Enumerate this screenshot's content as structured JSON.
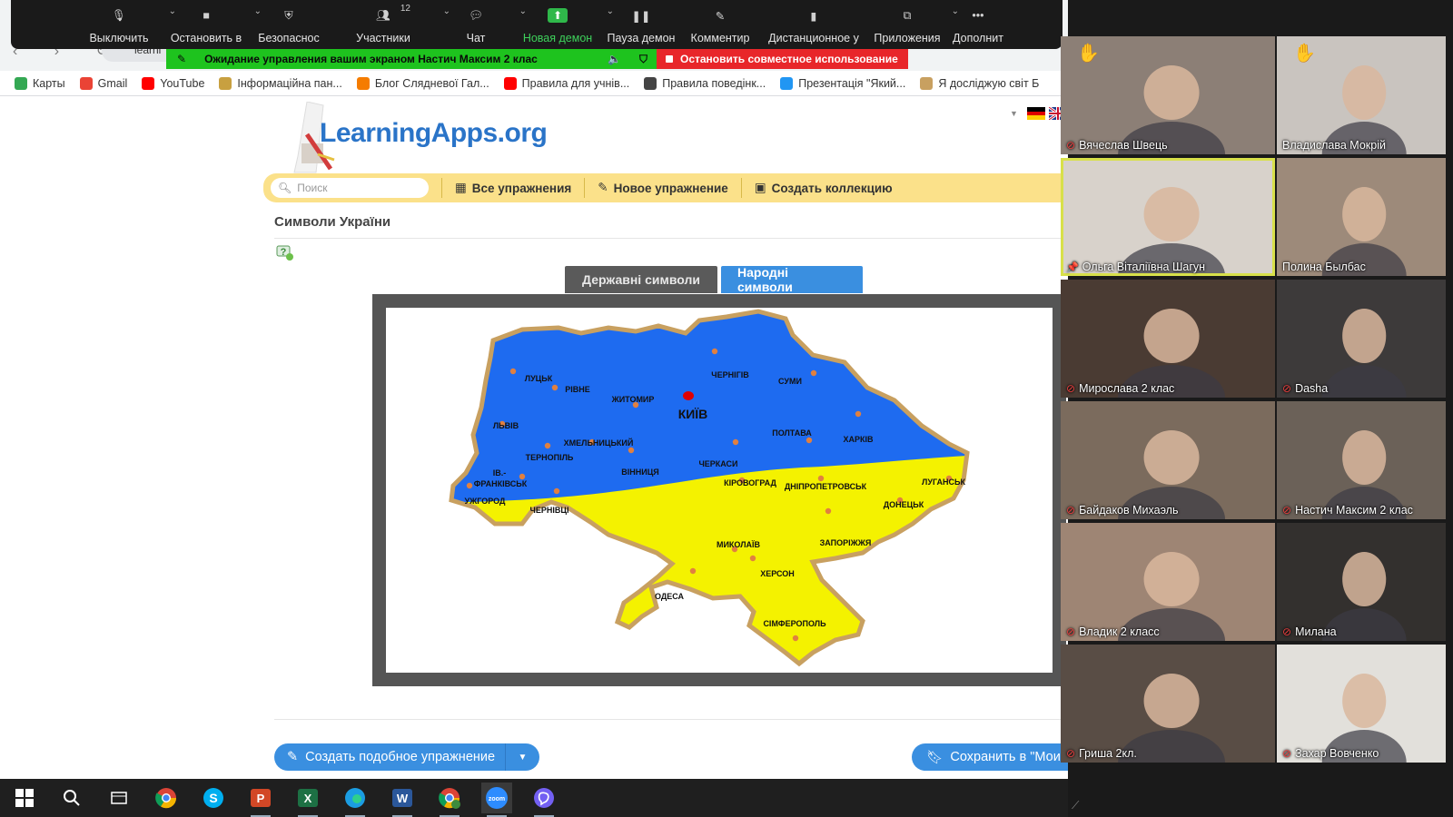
{
  "zoom_toolbar": {
    "items": [
      {
        "label": "Выключить",
        "icon": "microphone-icon"
      },
      {
        "label": "Остановить в",
        "icon": "video-camera-icon"
      },
      {
        "label": "Безопаснос",
        "icon": "shield-icon"
      },
      {
        "label": "Участники",
        "icon": "participants-icon",
        "count": "12"
      },
      {
        "label": "Чат",
        "icon": "chat-icon"
      },
      {
        "label": "Новая демон",
        "icon": "share-screen-icon"
      },
      {
        "label": "Пауза демон",
        "icon": "pause-icon"
      },
      {
        "label": "Комментир",
        "icon": "pencil-icon"
      },
      {
        "label": "Дистанционное у",
        "icon": "mouse-icon"
      },
      {
        "label": "Приложения",
        "icon": "apps-icon"
      },
      {
        "label": "Дополнит",
        "icon": "more-icon"
      }
    ],
    "sharing_banner": "Ожидание управления вашим экраном Настич Максим 2 клас",
    "stop_sharing": "Остановить совместное использование"
  },
  "browser": {
    "url_fragment": "learni",
    "bookmarks": [
      {
        "label": "Карты",
        "color": "#34a853"
      },
      {
        "label": "Gmail",
        "color": "#ea4335"
      },
      {
        "label": "YouTube",
        "color": "#ff0000"
      },
      {
        "label": "Інформаційна пан...",
        "color": "#c8a040"
      },
      {
        "label": "Блог Слядневої Гал...",
        "color": "#f57c00"
      },
      {
        "label": "Правила для учнів...",
        "color": "#ff0000"
      },
      {
        "label": "Правила поведінк...",
        "color": "#444444"
      },
      {
        "label": "Презентація \"Який...",
        "color": "#2196f3"
      },
      {
        "label": "Я досліджую світ Б",
        "color": "#c8a060"
      }
    ]
  },
  "learningapps": {
    "logo_text": "LearningApps.org",
    "search_placeholder": "Поиск",
    "nav": {
      "all_exercises": "Все упражнения",
      "new_exercise": "Новое упражнение",
      "create_collection": "Создать коллекцию"
    },
    "page_title": "Символи України",
    "tabs": [
      {
        "label": "Державні символи",
        "active": false
      },
      {
        "label": "Народні символи",
        "active": true
      }
    ],
    "create_similar": "Создать подобное упражнение",
    "save_to": "Сохранить в \"Моих у"
  },
  "map": {
    "colors": {
      "top": "#1e6bf0",
      "bottom": "#f4f200",
      "border": "#c8a060",
      "city": "#e08040",
      "capital": "#e00000"
    },
    "capital": "КИЇВ",
    "cities": [
      "ЛУЦЬК",
      "РІВНЕ",
      "ЖИТОМИР",
      "ЧЕРНІГІВ",
      "СУМИ",
      "ЛЬВІВ",
      "ХМЕЛЬНИЦЬКИЙ",
      "ТЕРНОПІЛЬ",
      "ПОЛТАВА",
      "ХАРКІВ",
      "ІВ.-",
      "ФРАНКІВСЬК",
      "ВІННИЦЯ",
      "ЧЕРКАСИ",
      "УЖГОРОД",
      "ЧЕРНІВЦІ",
      "КІРОВОГРАД",
      "ДНІПРОПЕТРОВСЬК",
      "ЛУГАНСЬК",
      "ДОНЕЦЬК",
      "МИКОЛАЇВ",
      "ЗАПОРІЖЖЯ",
      "ОДЕСА",
      "ХЕРСОН",
      "СІМФЕРОПОЛЬ"
    ]
  },
  "gallery": {
    "participants": [
      {
        "name": "Вячеслав Швець",
        "muted": true,
        "bg": "#8c7f76",
        "raised_hand": true
      },
      {
        "name": "Владислава Мокрій",
        "muted": false,
        "bg": "#c9c4bf",
        "raised_hand": true
      },
      {
        "name": "Ольга Віталіївна Шагун",
        "muted": false,
        "bg": "#d8d2cb",
        "pinned": true
      },
      {
        "name": "Полина Былбас",
        "muted": false,
        "bg": "#9d8a7a"
      },
      {
        "name": "Мирослава 2 клас",
        "muted": true,
        "bg": "#4a3b33"
      },
      {
        "name": "Dasha",
        "muted": true,
        "bg": "#3d3a3a"
      },
      {
        "name": "Байдаков Михаэль",
        "muted": true,
        "bg": "#7b6b5d"
      },
      {
        "name": "Настич Максим 2 клас",
        "muted": true,
        "bg": "#6b6158"
      },
      {
        "name": "Владик 2 класс",
        "muted": true,
        "bg": "#9e8574"
      },
      {
        "name": "Милана",
        "muted": true,
        "bg": "#33302e"
      },
      {
        "name": "Гриша 2кл.",
        "muted": true,
        "bg": "#594d45"
      },
      {
        "name": "Захар Вовченко",
        "muted": true,
        "bg": "#e2e0db"
      }
    ]
  },
  "taskbar": {
    "apps": [
      "windows-start-icon",
      "search-icon",
      "task-view-icon",
      "chrome-icon",
      "skype-icon",
      "powerpoint-icon",
      "excel-icon",
      "edge-icon",
      "word-icon",
      "chrome-profile-icon",
      "zoom-icon",
      "viber-icon"
    ]
  }
}
